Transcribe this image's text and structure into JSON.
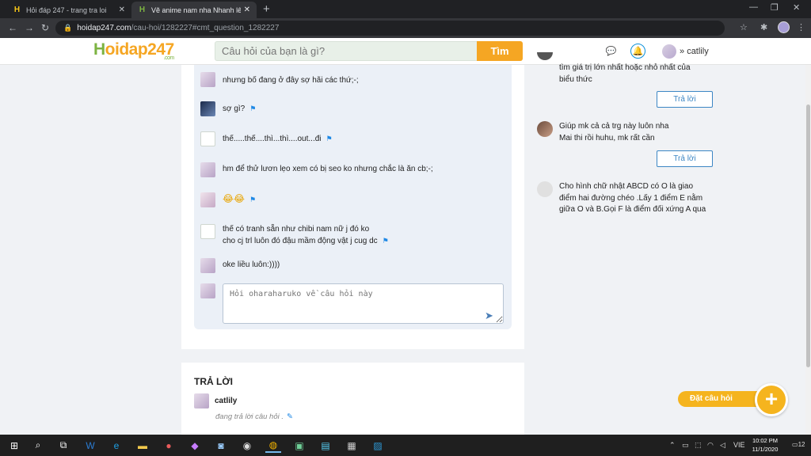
{
  "browser": {
    "tabs": [
      {
        "title": "Hỏi đáp 247 - trang tra loi"
      },
      {
        "title": "Vẽ anime nam nha Nhanh lên nh"
      }
    ],
    "url_host": "hoidap247.com",
    "url_path": "/cau-hoi/1282227#cmt_question_1282227"
  },
  "header": {
    "logo_main": "oidap247",
    "logo_h": "H",
    "logo_com": ".com",
    "search_placeholder": "Câu hỏi của bạn là gì?",
    "search_button": "Tìm",
    "username": "catlily",
    "user_caret": "»"
  },
  "comments": [
    {
      "text": "nhưng bố đang ở đây sợ hãi các thứ;-;",
      "flag": false
    },
    {
      "text": "sợ gì?",
      "flag": true
    },
    {
      "text": "thế.....thế....thì...thì....out...đi",
      "flag": true
    },
    {
      "text": "hm để thử lươn lẹo xem có bị seo ko nhưng chắc là ăn cb;-;",
      "flag": false
    },
    {
      "text": "😂😂",
      "flag": true
    },
    {
      "text": "thế có tranh sẵn như chibi nam nữ j đó  ko",
      "text2": "cho cj trl luôn đó đậu mầm động vật j cug dc",
      "flag": true
    },
    {
      "text": "oke liều luôn:))))",
      "flag": false
    }
  ],
  "reply_placeholder": "Hỏi oharaharuko về câu hỏi này",
  "answers": {
    "title": "TRẢ LỜI",
    "user": "catlily",
    "status": "đang trả lời câu hỏi ."
  },
  "sidebar": {
    "items": [
      {
        "line1": "tìm giá trị lớn nhất hoặc nhỏ nhất của",
        "line2": "biểu thức",
        "button": "Trả lời"
      },
      {
        "line1": "Giúp mk cả cả trg này luôn nha",
        "line2": "Mai thi rồi huhu, mk rất cần",
        "button": "Trả lời"
      },
      {
        "line1": "Cho hình chữ nhật ABCD có O là giao",
        "line2": "điểm hai đường chéo .Lấy 1 điểm E nằm",
        "line3": "giữa O và B.Gọi F là điểm đối xứng A qua"
      }
    ]
  },
  "ask_button": "Đặt câu hỏi",
  "taskbar": {
    "lang": "VIE",
    "time": "10:02 PM",
    "date": "11/1/2020",
    "notif": "12"
  }
}
